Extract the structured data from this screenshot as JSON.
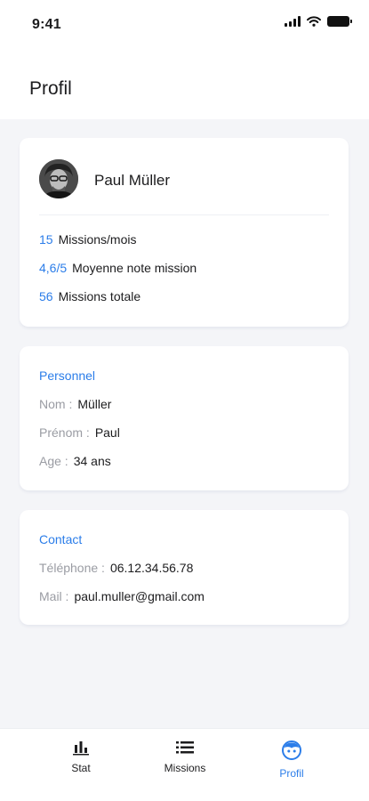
{
  "status_bar": {
    "time": "9:41",
    "icons": [
      "signal-icon",
      "wifi-icon",
      "battery-icon"
    ]
  },
  "header": {
    "title": "Profil"
  },
  "profile": {
    "name": "Paul Müller",
    "stats": [
      {
        "value": "15",
        "label": "Missions/mois"
      },
      {
        "value": "4,6/5",
        "label": "Moyenne note mission"
      },
      {
        "value": "56",
        "label": "Missions totale"
      }
    ]
  },
  "personal": {
    "title": "Personnel",
    "fields": [
      {
        "label": "Nom :",
        "value": "Müller"
      },
      {
        "label": "Prénom :",
        "value": "Paul"
      },
      {
        "label": "Age :",
        "value": "34 ans"
      }
    ]
  },
  "contact": {
    "title": "Contact",
    "fields": [
      {
        "label": "Téléphone :",
        "value": "06.12.34.56.78"
      },
      {
        "label": "Mail :",
        "value": "paul.muller@gmail.com"
      }
    ]
  },
  "tabs": [
    {
      "label": "Stat",
      "icon": "bar-chart-icon"
    },
    {
      "label": "Missions",
      "icon": "list-icon"
    },
    {
      "label": "Profil",
      "icon": "face-icon",
      "active": true
    }
  ],
  "colors": {
    "accent": "#2b7de9",
    "background": "#f4f5f8",
    "card": "#ffffff",
    "muted": "#9a9ca3"
  }
}
